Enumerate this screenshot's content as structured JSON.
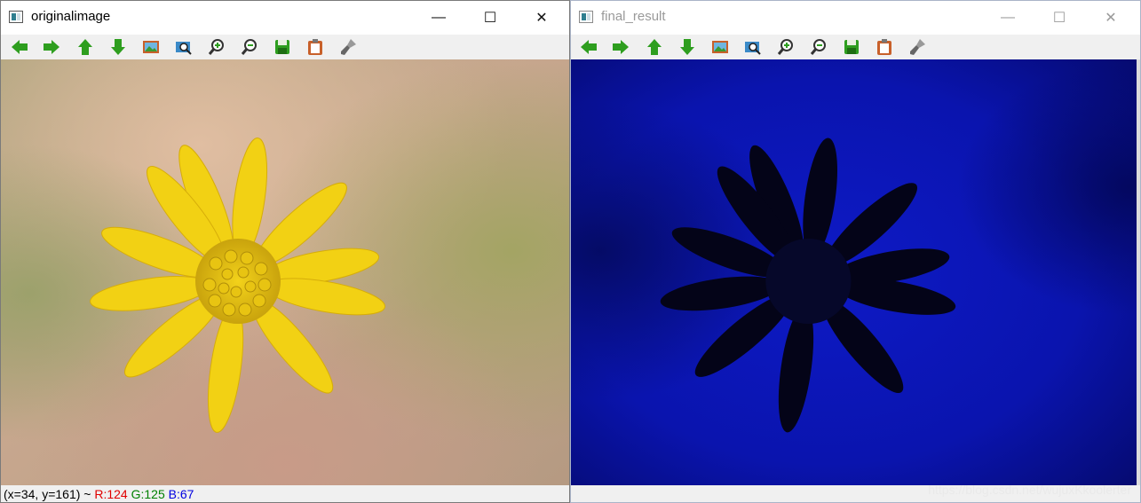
{
  "windows": [
    {
      "title": "originalimage",
      "controls": {
        "minimize": "—",
        "maximize": "☐",
        "close": "✕"
      },
      "status": {
        "coords": "(x=34, y=161) ~ ",
        "r": "R:124",
        "g": "G:125",
        "b": "B:67"
      }
    },
    {
      "title": "final_result",
      "controls": {
        "minimize": "—",
        "maximize": "☐",
        "close": "✕"
      },
      "watermark": "https://blog.csdn.net/wujuxKkoolerter"
    }
  ],
  "toolbar_icons": [
    "arrow-left-icon",
    "arrow-right-icon",
    "arrow-up-icon",
    "arrow-down-icon",
    "image-icon",
    "zoom-fit-icon",
    "zoom-in-icon",
    "zoom-out-icon",
    "save-icon",
    "copy-icon",
    "properties-icon"
  ],
  "colors": {
    "toolbar_green": "#2e9e1f",
    "result_blue": "#0a14b4",
    "petal_yellow": "#f2d114"
  }
}
